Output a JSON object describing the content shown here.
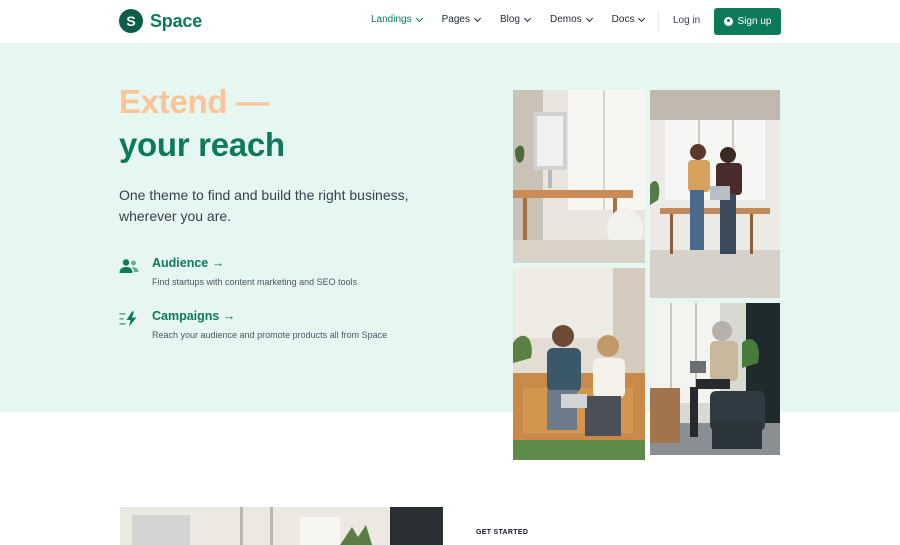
{
  "brand": {
    "name": "Space",
    "mark": "S"
  },
  "nav": {
    "items": [
      {
        "label": "Landings",
        "active": true
      },
      {
        "label": "Pages",
        "active": false
      },
      {
        "label": "Blog",
        "active": false
      },
      {
        "label": "Demos",
        "active": false
      },
      {
        "label": "Docs",
        "active": false
      }
    ],
    "login": "Log in",
    "signup": "Sign up"
  },
  "hero": {
    "headline_line1": "Extend —",
    "headline_line2": "your reach",
    "subtitle": "One theme to find and build the right business, wherever you are.",
    "features": [
      {
        "title": "Audience →",
        "description": "Find startups with content marketing and SEO tools",
        "icon": "users-icon"
      },
      {
        "title": "Campaigns →",
        "description": "Reach your audience and promote products all from Space",
        "icon": "bolt-icon"
      }
    ]
  },
  "section2": {
    "eyebrow": "GET STARTED"
  },
  "colors": {
    "brand": "#0e7a5c",
    "accent": "#fbc595",
    "hero_bg": "#e6f6f1"
  }
}
